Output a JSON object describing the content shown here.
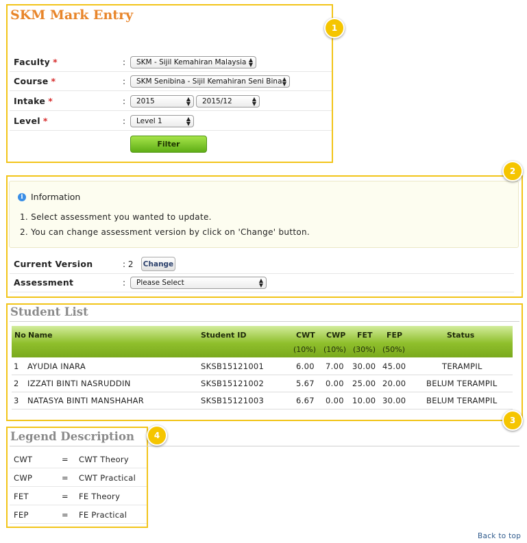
{
  "page_title": "SKM Mark Entry",
  "badges": [
    "1",
    "2",
    "3",
    "4"
  ],
  "filter_form": {
    "required_mark": "*",
    "colon": ":",
    "faculty": {
      "label": "Faculty",
      "value": "SKM - Sijil Kemahiran Malaysia"
    },
    "course": {
      "label": "Course",
      "value": "SKM Senibina - Sijil Kemahiran Seni Bina"
    },
    "intake": {
      "label": "Intake",
      "year": "2015",
      "session": "2015/12"
    },
    "level": {
      "label": "Level",
      "value": "Level 1"
    },
    "filter_button": "Filter"
  },
  "information": {
    "title": "Information",
    "items": [
      "1.  Select assessment you wanted to update.",
      "2.  You can change assessment version by click on 'Change' button."
    ]
  },
  "version": {
    "label": "Current Version",
    "colon": ": 2",
    "value": "2",
    "change_button": "Change"
  },
  "assessment": {
    "label": "Assessment",
    "colon": ":",
    "value": "Please Select"
  },
  "student_list": {
    "title": "Student List",
    "headers": {
      "no": "No",
      "name": "Name",
      "student_id": "Student ID",
      "cwt": "CWT",
      "cwp": "CWP",
      "fet": "FET",
      "fep": "FEP",
      "status": "Status",
      "cwt_pct": "(10%)",
      "cwp_pct": "(10%)",
      "fet_pct": "(30%)",
      "fep_pct": "(50%)"
    },
    "rows": [
      {
        "no": "1",
        "name": "AYUDIA INARA",
        "id": "SKSB15121001",
        "cwt": "6.00",
        "cwp": "7.00",
        "fet": "30.00",
        "fep": "45.00",
        "status": "TERAMPIL"
      },
      {
        "no": "2",
        "name": "IZZATI BINTI NASRUDDIN",
        "id": "SKSB15121002",
        "cwt": "5.67",
        "cwp": "0.00",
        "fet": "25.00",
        "fep": "20.00",
        "status": "BELUM TERAMPIL"
      },
      {
        "no": "3",
        "name": "NATASYA BINTI MANSHAHAR",
        "id": "SKSB15121003",
        "cwt": "6.67",
        "cwp": "0.00",
        "fet": "10.00",
        "fep": "30.00",
        "status": "BELUM TERAMPIL"
      }
    ]
  },
  "legend": {
    "title": "Legend Description",
    "items": [
      {
        "code": "CWT",
        "eq": "=",
        "desc": "CWT Theory"
      },
      {
        "code": "CWP",
        "eq": "=",
        "desc": "CWT Practical"
      },
      {
        "code": "FET",
        "eq": "=",
        "desc": "FE Theory"
      },
      {
        "code": "FEP",
        "eq": "=",
        "desc": "FE Practical"
      }
    ]
  },
  "footer": {
    "back_to_top": "Back to top"
  },
  "colors": {
    "title": "#e8852a",
    "callout": "#f2c418",
    "table_header": "#8fbf2c",
    "button": "#6dbb1f"
  }
}
